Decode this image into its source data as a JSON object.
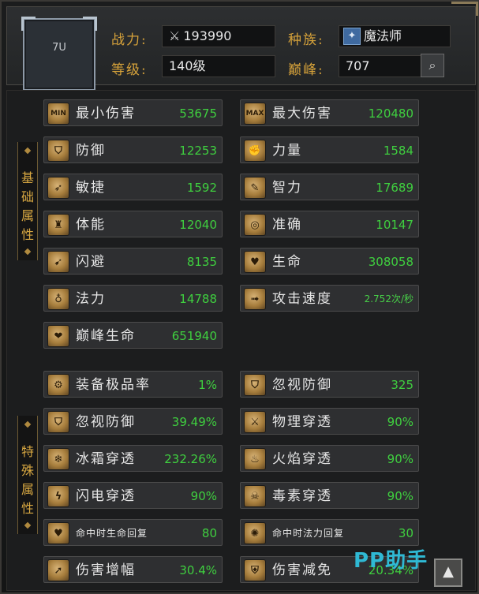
{
  "header": {
    "portrait_label": "7U",
    "power_label": "战力:",
    "power_value": "193990",
    "level_label": "等级:",
    "level_value": "140级",
    "race_label": "种族:",
    "race_value": "魔法师",
    "peak_label": "巅峰:",
    "peak_value": "707"
  },
  "sections": {
    "basic": "基础属性",
    "special": "特殊属性"
  },
  "basic_stats": [
    {
      "icon": "MIN",
      "name": "最小伤害",
      "value": "53675"
    },
    {
      "icon": "MAX",
      "name": "最大伤害",
      "value": "120480"
    },
    {
      "icon": "shield",
      "name": "防御",
      "value": "12253"
    },
    {
      "icon": "fist",
      "name": "力量",
      "value": "1584"
    },
    {
      "icon": "dash",
      "name": "敏捷",
      "value": "1592"
    },
    {
      "icon": "brain",
      "name": "智力",
      "value": "17689"
    },
    {
      "icon": "body",
      "name": "体能",
      "value": "12040"
    },
    {
      "icon": "target",
      "name": "准确",
      "value": "10147"
    },
    {
      "icon": "dodge",
      "name": "闪避",
      "value": "8135"
    },
    {
      "icon": "heart",
      "name": "生命",
      "value": "308058"
    },
    {
      "icon": "potion",
      "name": "法力",
      "value": "14788"
    },
    {
      "icon": "speed",
      "name": "攻击速度",
      "value": "2.752次/秒"
    },
    {
      "icon": "peak-heart",
      "name": "巅峰生命",
      "value": "651940"
    }
  ],
  "special_stats": [
    {
      "icon": "gear",
      "name": "装备极品率",
      "value": "1%"
    },
    {
      "icon": "armor-break",
      "name": "忽视防御",
      "value": "325"
    },
    {
      "icon": "armor-break",
      "name": "忽视防御",
      "value": "39.49%"
    },
    {
      "icon": "physical",
      "name": "物理穿透",
      "value": "90%"
    },
    {
      "icon": "frost",
      "name": "冰霜穿透",
      "value": "232.26%"
    },
    {
      "icon": "flame",
      "name": "火焰穿透",
      "value": "90%"
    },
    {
      "icon": "lightning",
      "name": "闪电穿透",
      "value": "90%"
    },
    {
      "icon": "poison",
      "name": "毒素穿透",
      "value": "90%"
    },
    {
      "icon": "life-regen",
      "name": "命中时生命回复",
      "value": "80"
    },
    {
      "icon": "mana-regen",
      "name": "命中时法力回复",
      "value": "30"
    },
    {
      "icon": "damage-up",
      "name": "伤害增幅",
      "value": "30.4%"
    },
    {
      "icon": "damage-down",
      "name": "伤害减免",
      "value": "20.34%"
    }
  ],
  "watermark": "PP助手",
  "colors": {
    "gold_label": "#d6a23a",
    "value_green": "#3fcf3f"
  }
}
